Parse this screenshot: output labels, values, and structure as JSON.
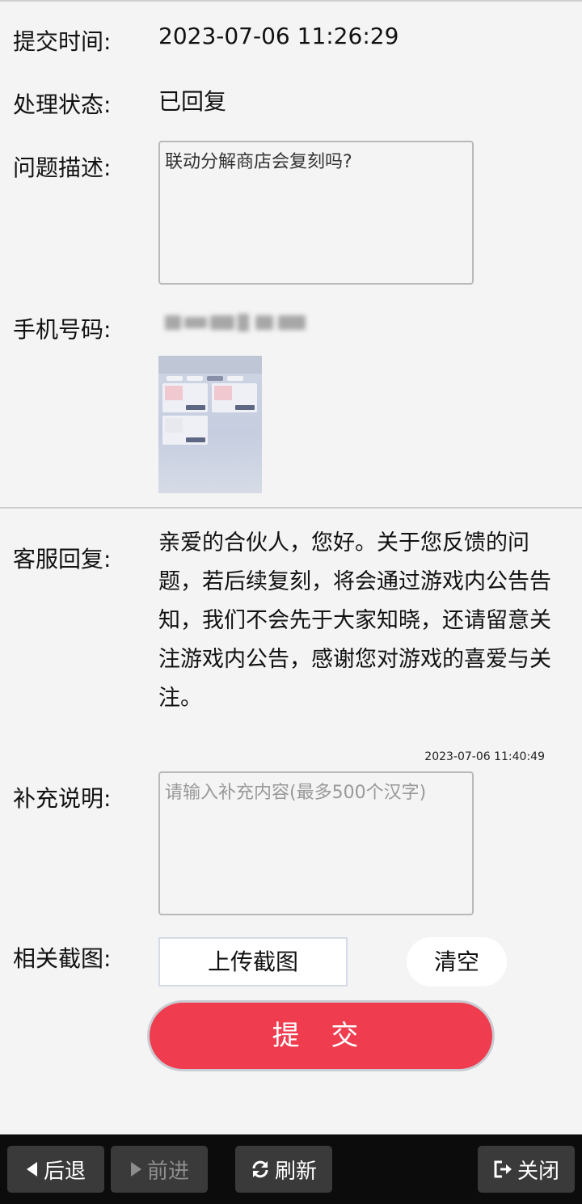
{
  "fields": {
    "submit_time_label": "提交时间:",
    "submit_time_value": "2023-07-06 11:26:29",
    "status_label": "处理状态:",
    "status_value": "已回复",
    "description_label": "问题描述:",
    "description_value": "联动分解商店会复刻吗?",
    "phone_label": "手机号码:"
  },
  "reply": {
    "label": "客服回复:",
    "text": "亲爱的合伙人，您好。关于您反馈的问题，若后续复刻，将会通过游戏内公告告知，我们不会先于大家知晓，还请留意关注游戏内公告，感谢您对游戏的喜爱与关注。",
    "time": "2023-07-06 11:40:49"
  },
  "supplement": {
    "label": "补充说明:",
    "placeholder": "请输入补充内容(最多500个汉字)",
    "value": ""
  },
  "screenshot": {
    "label": "相关截图:",
    "upload_label": "上传截图",
    "clear_label": "清空"
  },
  "submit_label": "提 交",
  "toolbar": {
    "back_label": "后退",
    "forward_label": "前进",
    "refresh_label": "刷新",
    "close_label": "关闭"
  },
  "colors": {
    "accent": "#ef3c4f",
    "background": "#f4f4f4",
    "toolbar": "#0c0c0c"
  },
  "icons": [
    "back-arrow-icon",
    "forward-arrow-icon",
    "refresh-icon",
    "exit-icon"
  ]
}
